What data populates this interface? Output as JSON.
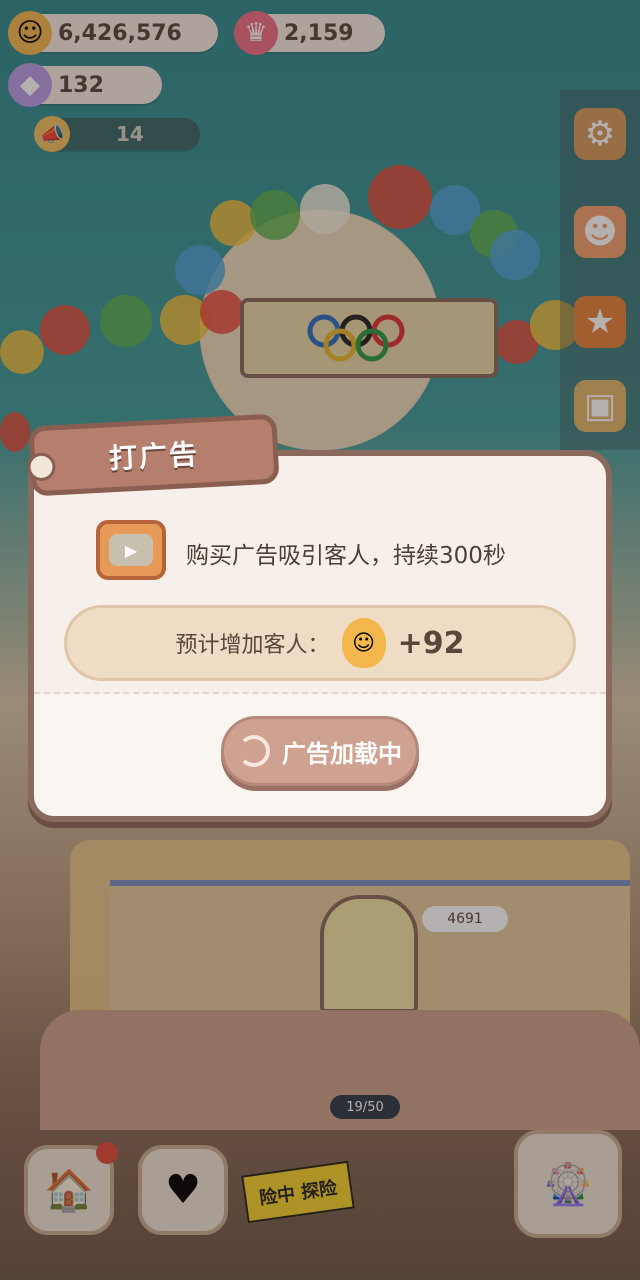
{
  "resources": {
    "coins": "6,426,576",
    "gems": "2,159",
    "crystals": "132",
    "announce_count": "14"
  },
  "dialog": {
    "title": "打广告",
    "description": "购买广告吸引客人，持续300秒",
    "estimate_label": "预计增加客人：",
    "estimate_value": "+92",
    "load_button": "广告加载中"
  },
  "scene": {
    "customer_count": "4691",
    "capacity": "19/50",
    "explore_tape": "险中 探险"
  },
  "icons": {
    "coin": "cookie-face-icon",
    "gem": "pink-gem-icon",
    "crystal": "crystal-icon",
    "megaphone": "megaphone-icon",
    "settings": "gear-icon",
    "stamp": "stamp-icon",
    "medal": "medal-icon",
    "backpack": "backpack-icon",
    "tv": "tv-icon",
    "hotel": "hotel-icon",
    "calendar": "calendar-icon",
    "ferris": "ferris-wheel-icon"
  }
}
